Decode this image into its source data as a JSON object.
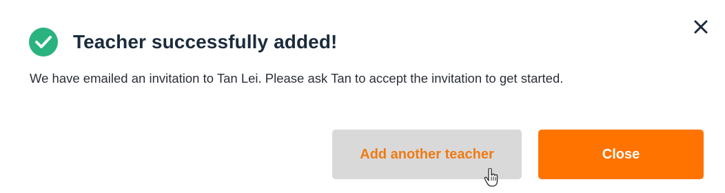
{
  "dialog": {
    "title": "Teacher successfully added!",
    "message": "We have emailed an invitation to Tan Lei. Please ask Tan to accept the invitation to get started.",
    "icons": {
      "status": "check-circle-icon",
      "close": "close-icon",
      "cursor": "hand-pointer-icon"
    },
    "buttons": {
      "add_another_label": "Add another teacher",
      "close_label": "Close"
    },
    "colors": {
      "success": "#2ab37f",
      "accent": "#ff7300",
      "secondary_bg": "#d9d9d9",
      "title_text": "#1c2b3c"
    }
  }
}
